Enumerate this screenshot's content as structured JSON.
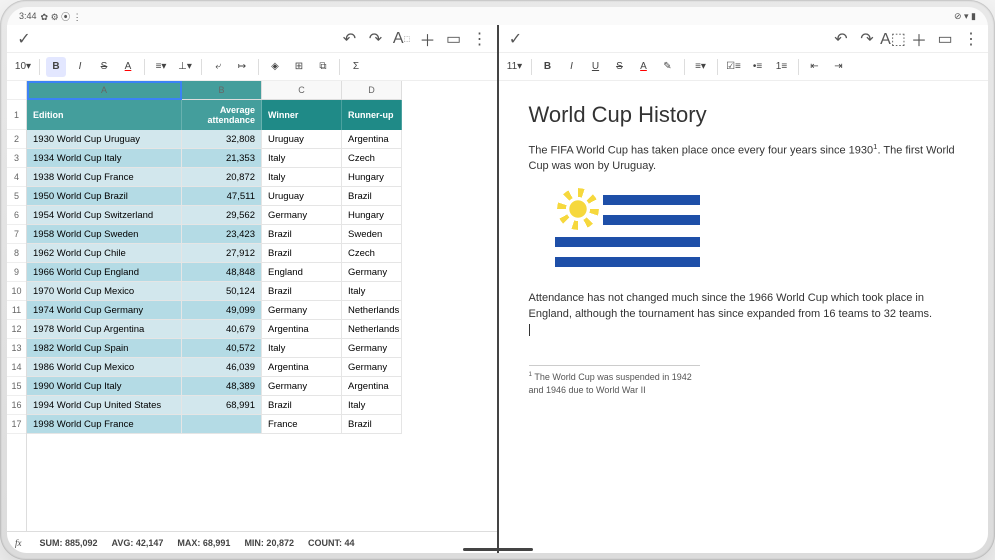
{
  "status": {
    "time": "3:44",
    "icons_left": "✿ ⚙ ⦿ ⋮",
    "icons_right": "⊘ ▾ ▮"
  },
  "sheets": {
    "font_size": "10",
    "toolbar_top": [
      "undo",
      "redo",
      "font",
      "add",
      "comment",
      "more"
    ],
    "toolbar2": [
      "B",
      "I",
      "S",
      "A",
      "align",
      "valign",
      "wrap",
      "overflow",
      "fill",
      "border",
      "merge",
      "fn"
    ],
    "col_letters": [
      "A",
      "B",
      "C",
      "D"
    ],
    "headers": [
      "Edition",
      "Average attendance",
      "Winner",
      "Runner-up"
    ],
    "rows": [
      {
        "n": 1,
        "a": "1930 World Cup Uruguay",
        "b": "32,808",
        "c": "Uruguay",
        "d": "Argentina"
      },
      {
        "n": 2,
        "a": "1934 World Cup Italy",
        "b": "21,353",
        "c": "Italy",
        "d": "Czech"
      },
      {
        "n": 3,
        "a": "1938 World Cup France",
        "b": "20,872",
        "c": "Italy",
        "d": "Hungary"
      },
      {
        "n": 4,
        "a": "1950 World Cup Brazil",
        "b": "47,511",
        "c": "Uruguay",
        "d": "Brazil"
      },
      {
        "n": 5,
        "a": "1954 World Cup Switzerland",
        "b": "29,562",
        "c": "Germany",
        "d": "Hungary"
      },
      {
        "n": 6,
        "a": "1958 World Cup Sweden",
        "b": "23,423",
        "c": "Brazil",
        "d": "Sweden"
      },
      {
        "n": 7,
        "a": "1962 World Cup Chile",
        "b": "27,912",
        "c": "Brazil",
        "d": "Czech"
      },
      {
        "n": 8,
        "a": "1966 World Cup England",
        "b": "48,848",
        "c": "England",
        "d": "Germany"
      },
      {
        "n": 9,
        "a": "1970 World Cup Mexico",
        "b": "50,124",
        "c": "Brazil",
        "d": "Italy"
      },
      {
        "n": 10,
        "a": "1974 World Cup Germany",
        "b": "49,099",
        "c": "Germany",
        "d": "Netherlands"
      },
      {
        "n": 11,
        "a": "1978 World Cup Argentina",
        "b": "40,679",
        "c": "Argentina",
        "d": "Netherlands"
      },
      {
        "n": 12,
        "a": "1982 World Cup Spain",
        "b": "40,572",
        "c": "Italy",
        "d": "Germany"
      },
      {
        "n": 13,
        "a": "1986 World Cup Mexico",
        "b": "46,039",
        "c": "Argentina",
        "d": "Germany"
      },
      {
        "n": 14,
        "a": "1990 World Cup Italy",
        "b": "48,389",
        "c": "Germany",
        "d": "Argentina"
      },
      {
        "n": 15,
        "a": "1994 World Cup United States",
        "b": "68,991",
        "c": "Brazil",
        "d": "Italy"
      },
      {
        "n": 16,
        "a": "1998 World Cup France",
        "b": "",
        "c": "France",
        "d": "Brazil"
      }
    ],
    "stats": {
      "sum": "SUM: 885,092",
      "avg": "AVG: 42,147",
      "max": "MAX: 68,991",
      "min": "MIN: 20,872",
      "count": "COUNT: 44"
    }
  },
  "docs": {
    "font_size": "11",
    "title": "World Cup History",
    "p1_a": "The FIFA World Cup has taken place once every four years since 1930",
    "p1_b": ". The first World Cup was won by Uruguay.",
    "p2": "Attendance has not changed much since the 1966 World Cup which took place in England, although the tournament has since expanded from 16 teams to 32 teams.",
    "footnote_sup": "1",
    "footnote": " The World Cup was suspended in 1942 and 1946 due to World War II"
  }
}
